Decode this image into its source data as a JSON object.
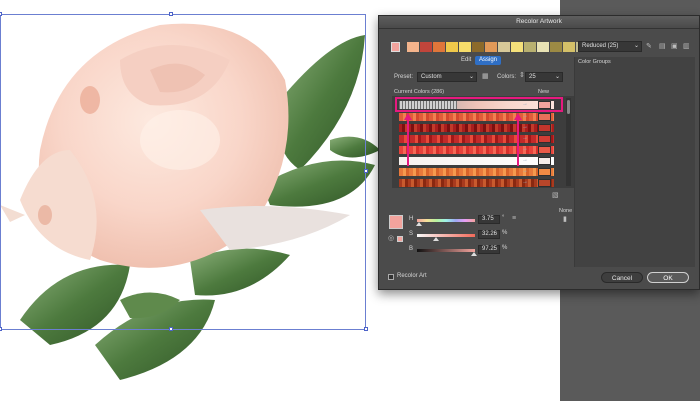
{
  "dialog": {
    "title": "Recolor Artwork",
    "reduced_select": "Reduced (25)",
    "tabs": [
      "Edit",
      "Assign"
    ],
    "preset_label": "Preset:",
    "preset_value": "Custom",
    "colors_label": "Colors:",
    "colors_value": "25",
    "current_colors_label": "Current Colors (286)",
    "new_label": "New",
    "color_groups_label": "Color Groups",
    "none_label": "None",
    "h_label": "H",
    "h_value": "3.75",
    "h_unit": "°",
    "s_label": "S",
    "s_value": "32.26",
    "s_unit": "%",
    "b_label": "B",
    "b_value": "97.25",
    "b_unit": "%",
    "recolor_art_label": "Recolor Art",
    "cancel_label": "Cancel",
    "ok_label": "OK"
  },
  "colors": {
    "highlight": "#e6197f",
    "dialog_bg": "#4b4b4b",
    "selected_swatch": "#f2a39d"
  },
  "icons": [
    "eyedropper-icon",
    "save-group-icon",
    "new-group-icon",
    "delete-group-icon",
    "color-mode-icon",
    "expand-icon"
  ]
}
